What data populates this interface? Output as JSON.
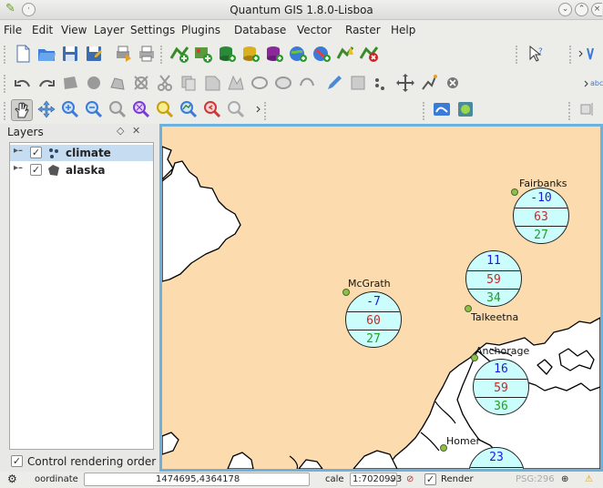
{
  "window": {
    "title": "Quantum GIS 1.8.0-Lisboa"
  },
  "menu": [
    "File",
    "Edit",
    "View",
    "Layer",
    "Settings",
    "Plugins",
    "Database",
    "Vector",
    "Raster",
    "Help"
  ],
  "layers_panel": {
    "title": "Layers",
    "layers": [
      {
        "name": "climate",
        "checked": true,
        "selected": true,
        "icon": "point-layer-icon"
      },
      {
        "name": "alaska",
        "checked": true,
        "selected": false,
        "icon": "polygon-layer-icon"
      }
    ],
    "control_rendering_order": {
      "label": "Control rendering order",
      "checked": true
    }
  },
  "map": {
    "cities": [
      "Fairbanks",
      "McGrath",
      "Talkeetna",
      "Anchorage",
      "Homer"
    ],
    "diagrams": [
      {
        "city": "Fairbanks",
        "values": [
          "-10",
          "63",
          "27"
        ]
      },
      {
        "city": "Talkeetna",
        "values": [
          "11",
          "59",
          "34"
        ]
      },
      {
        "city": "McGrath",
        "values": [
          "-7",
          "60",
          "27"
        ]
      },
      {
        "city": "Anchorage",
        "values": [
          "16",
          "59",
          "36"
        ]
      },
      {
        "city": "Homer",
        "values": [
          "23",
          "",
          ""
        ]
      }
    ],
    "colors": {
      "land": "#fcdcae",
      "diagram": "#ccfdfd",
      "v1": "#1a1adc",
      "v2": "#c82828",
      "v3": "#22a022",
      "frame": "#6eb1dc"
    }
  },
  "statusbar": {
    "coordinate_label": "oordinate",
    "coordinate_value": "1474695,4364178",
    "scale_label": "cale",
    "scale_value": "1:7020993",
    "render_label": "Render",
    "crs": "PSG:296"
  }
}
